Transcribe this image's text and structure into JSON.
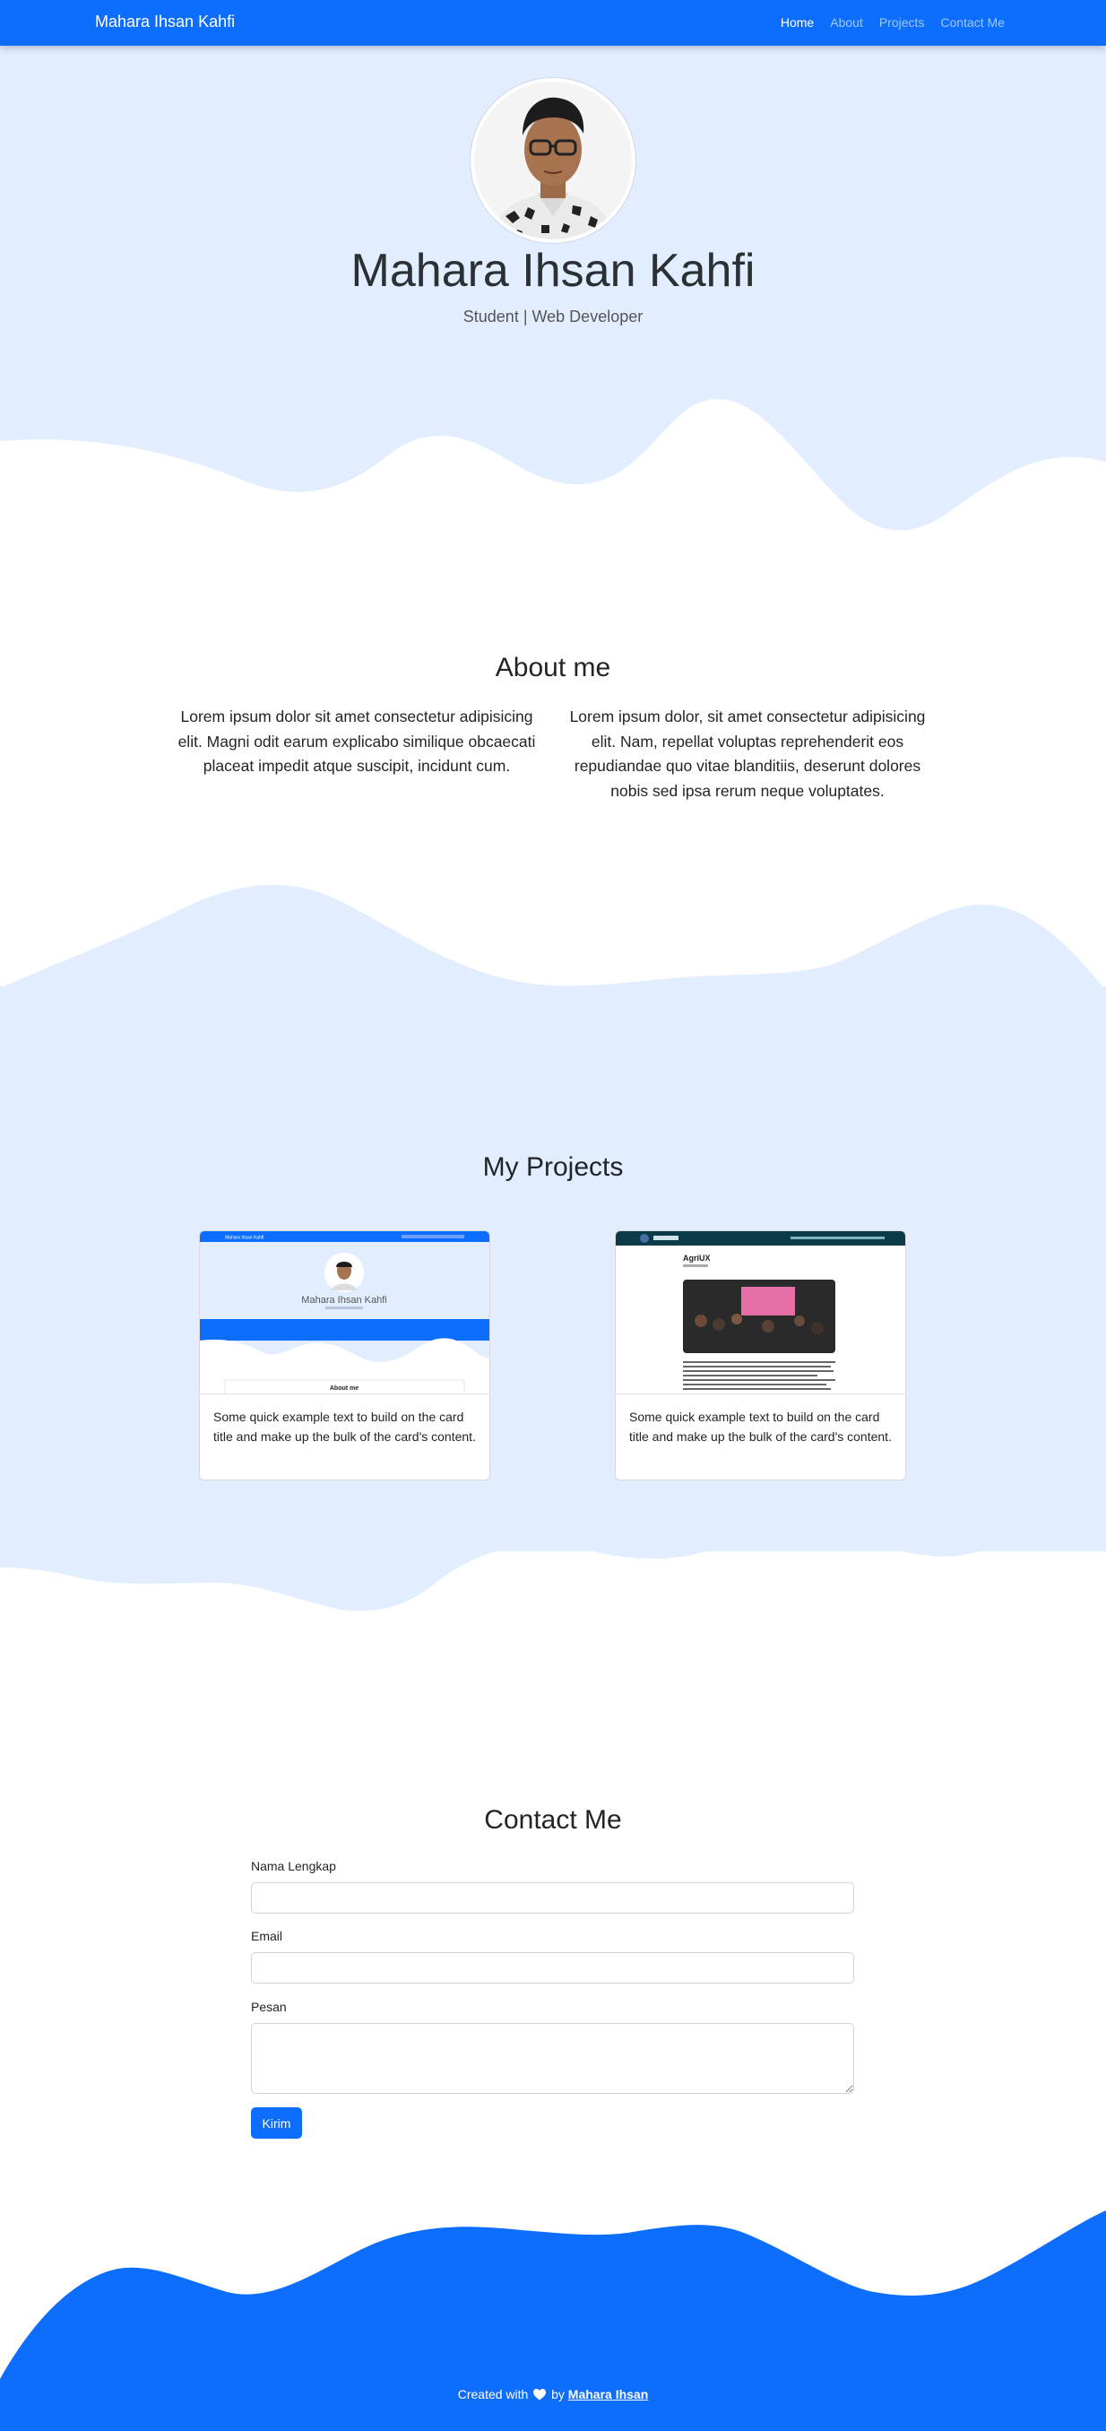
{
  "navbar": {
    "brand": "Mahara Ihsan Kahfi",
    "links": [
      {
        "label": "Home",
        "active": true
      },
      {
        "label": "About",
        "active": false
      },
      {
        "label": "Projects",
        "active": false
      },
      {
        "label": "Contact Me",
        "active": false
      }
    ]
  },
  "hero": {
    "name": "Mahara Ihsan Kahfi",
    "subtitle": "Student | Web Developer"
  },
  "about": {
    "title": "About me",
    "paragraphs": [
      "Lorem ipsum dolor sit amet consectetur adipisicing elit. Magni odit earum explicabo similique obcaecati placeat impedit atque suscipit, incidunt cum.",
      "Lorem ipsum dolor, sit amet consectetur adipisicing elit. Nam, repellat voluptas reprehenderit eos repudiandae quo vitae blanditiis, deserunt dolores nobis sed ipsa rerum neque voluptates."
    ]
  },
  "projects": {
    "title": "My Projects",
    "cards": [
      {
        "text": "Some quick example text to build on the card title and make up the bulk of the card's content.",
        "preview": {
          "brand": "Mahara Ihsan Kahfi",
          "name": "Mahara Ihsan Kahfi",
          "section": "About me"
        }
      },
      {
        "text": "Some quick example text to build on the card title and make up the bulk of the card's content.",
        "preview": {
          "title": "AgriUX"
        }
      }
    ]
  },
  "contact": {
    "title": "Contact Me",
    "fields": [
      {
        "label": "Nama Lengkap",
        "value": ""
      },
      {
        "label": "Email",
        "value": ""
      },
      {
        "label": "Pesan",
        "value": ""
      }
    ],
    "submit_label": "Kirim"
  },
  "footer": {
    "prefix": "Created with",
    "by": "by",
    "author": "Mahara Ihsan"
  },
  "colors": {
    "primary": "#0d6efd",
    "light_blue": "#e2edff"
  }
}
